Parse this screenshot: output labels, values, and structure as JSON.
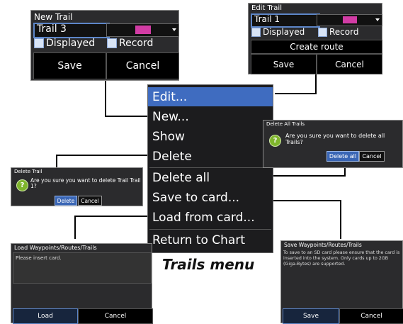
{
  "new_trail": {
    "title": "New Trail",
    "name_value": "Trail 3",
    "displayed_label": "Displayed",
    "record_label": "Record",
    "save_label": "Save",
    "cancel_label": "Cancel"
  },
  "edit_trail": {
    "title": "Edit Trail",
    "name_value": "Trail 1",
    "displayed_label": "Displayed",
    "record_label": "Record",
    "create_route_label": "Create route",
    "save_label": "Save",
    "cancel_label": "Cancel"
  },
  "trails_menu": {
    "items": [
      "Edit...",
      "New...",
      "Show",
      "Delete",
      "Delete all",
      "Save to card...",
      "Load from card...",
      "Return to Chart"
    ],
    "caption": "Trails menu"
  },
  "delete_trail": {
    "title": "Delete Trail",
    "message": "Are you sure you want to delete Trail Trail 1?",
    "delete_label": "Delete",
    "cancel_label": "Cancel"
  },
  "delete_all_trails": {
    "title": "Delete All Trails",
    "message": "Are you sure you want to delete all Trails?",
    "delete_all_label": "Delete all",
    "cancel_label": "Cancel"
  },
  "load_dialog": {
    "title": "Load Waypoints/Routes/Trails",
    "message": "Please insert card.",
    "load_label": "Load",
    "cancel_label": "Cancel"
  },
  "save_dialog": {
    "title": "Save Waypoints/Routes/Trails",
    "message": "To save to an SD card please ensure that the card is inserted into the system. Only cards up to 2GB (Giga-Bytes) are supported.",
    "save_label": "Save",
    "cancel_label": "Cancel"
  },
  "colors": {
    "dialog_bg": "#2b2b2d",
    "highlight": "#3f6cc0",
    "trail_color": "#d23ca5",
    "question_icon": "#7fb52c"
  },
  "icons": [
    "checkbox-checked-icon",
    "question-icon",
    "dropdown-arrow-icon"
  ]
}
